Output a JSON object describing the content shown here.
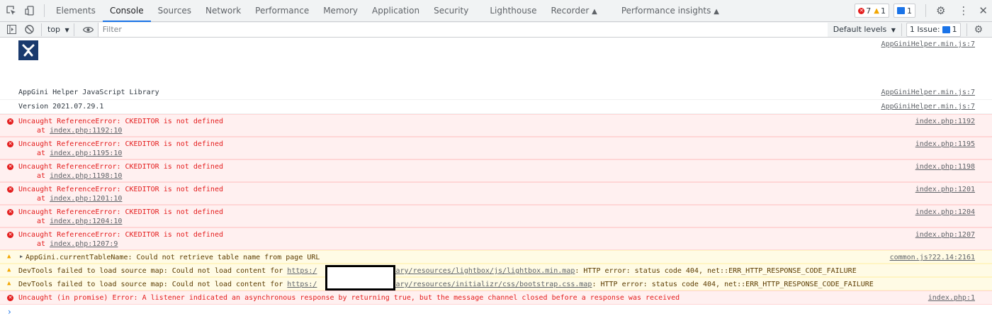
{
  "tabs": [
    "Elements",
    "Console",
    "Sources",
    "Network",
    "Performance",
    "Memory",
    "Application",
    "Security",
    "Lighthouse",
    "Recorder",
    "Performance insights"
  ],
  "active_tab": "Console",
  "counts": {
    "errors": "7",
    "warnings": "1",
    "issues": "1"
  },
  "toolbar": {
    "context": "top",
    "filter_placeholder": "Filter",
    "levels": "Default levels",
    "issues_label": "1 Issue:",
    "issues_count": "1"
  },
  "logo_row": {
    "source": "AppGiniHelper.min.js:7"
  },
  "logs": [
    {
      "text": "AppGini Helper JavaScript Library",
      "source": "AppGiniHelper.min.js:7"
    },
    {
      "text": "Version 2021.07.29.1",
      "source": "AppGiniHelper.min.js:7"
    }
  ],
  "errors": [
    {
      "message": "Uncaught ReferenceError: CKEDITOR is not defined",
      "at_prefix": "at ",
      "at_link": "index.php:1192:10",
      "source": "index.php:1192"
    },
    {
      "message": "Uncaught ReferenceError: CKEDITOR is not defined",
      "at_prefix": "at ",
      "at_link": "index.php:1195:10",
      "source": "index.php:1195"
    },
    {
      "message": "Uncaught ReferenceError: CKEDITOR is not defined",
      "at_prefix": "at ",
      "at_link": "index.php:1198:10",
      "source": "index.php:1198"
    },
    {
      "message": "Uncaught ReferenceError: CKEDITOR is not defined",
      "at_prefix": "at ",
      "at_link": "index.php:1201:10",
      "source": "index.php:1201"
    },
    {
      "message": "Uncaught ReferenceError: CKEDITOR is not defined",
      "at_prefix": "at ",
      "at_link": "index.php:1204:10",
      "source": "index.php:1204"
    },
    {
      "message": "Uncaught ReferenceError: CKEDITOR is not defined",
      "at_prefix": "at ",
      "at_link": "index.php:1207:9",
      "source": "index.php:1207"
    }
  ],
  "warnings": [
    {
      "text": "AppGini.currentTableName: Could not retrieve table name from page URL",
      "source": "common.js?22.14:2161"
    },
    {
      "prefix": "DevTools failed to load source map: Could not load content for ",
      "link_a": "https:/",
      "link_b": "diary/resources/lightbox/js/lightbox.min.map",
      "suffix": ": HTTP error: status code 404, net::ERR_HTTP_RESPONSE_CODE_FAILURE"
    },
    {
      "prefix": "DevTools failed to load source map: Could not load content for ",
      "link_a": "https:/",
      "link_b": "diary/resources/initializr/css/bootstrap.css.map",
      "suffix": ": HTTP error: status code 404, net::ERR_HTTP_RESPONSE_CODE_FAILURE"
    }
  ],
  "final_error": {
    "text": "Uncaught (in promise) Error: A listener indicated an asynchronous response by returning true, but the message channel closed before a response was received",
    "source": "index.php:1"
  },
  "prompt_symbol": "›",
  "colors": {
    "error": "#e41c1c",
    "error_bg": "#fff0f0",
    "warn_bg": "#fffbe5",
    "accent": "#1a73e8"
  }
}
